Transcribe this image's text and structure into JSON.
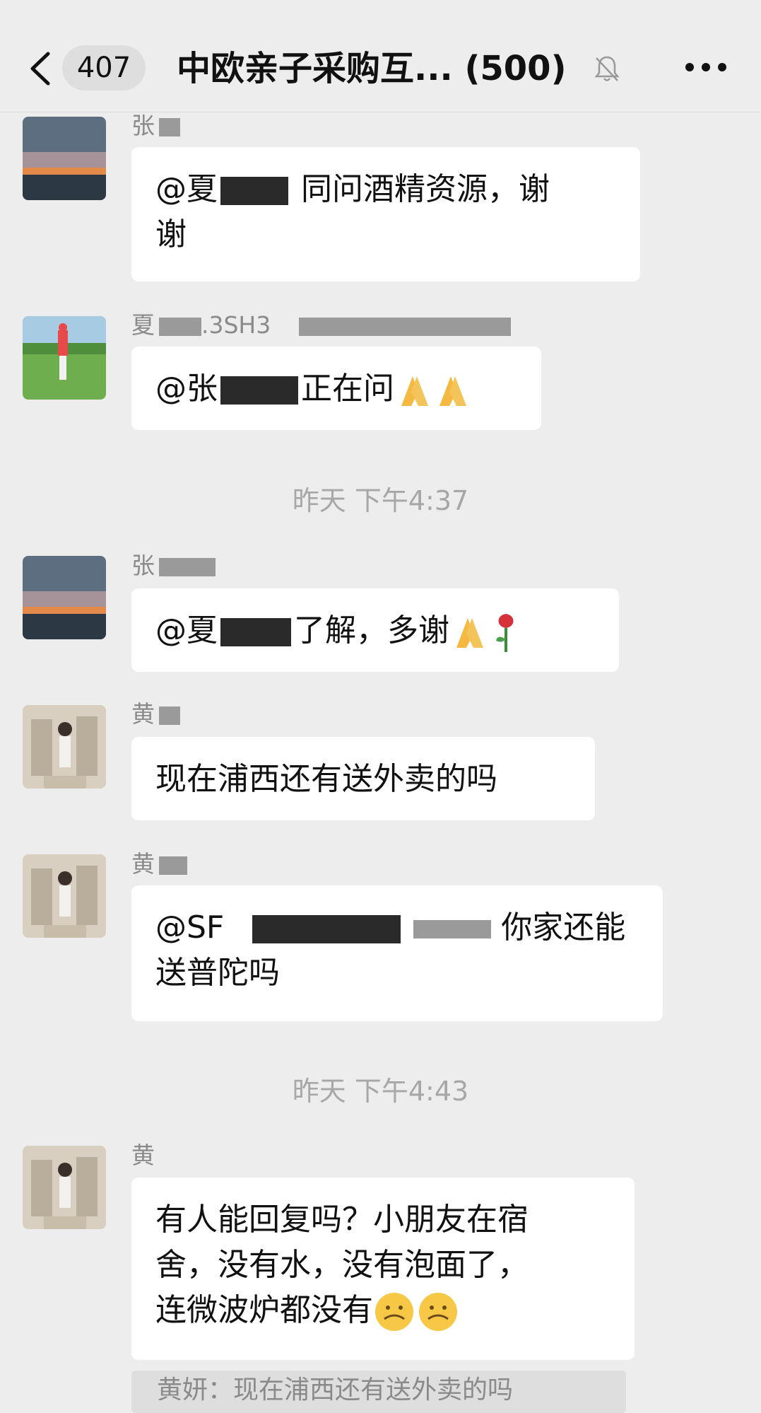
{
  "header": {
    "unread_count": "407",
    "title": "中欧亲子采购互...",
    "member_count": "(500)"
  },
  "messages": [
    {
      "sender": "张",
      "text_prefix": "@夏",
      "text_line1": "同问酒精资源，谢",
      "text_line2": "谢"
    },
    {
      "sender": "夏",
      "sender_suffix": ".3SH3",
      "text_prefix": "@张",
      "text": "正在问"
    },
    {
      "sender": "张",
      "text_prefix": "@夏",
      "text": "了解，多谢"
    },
    {
      "sender": "黄",
      "text": "现在浦西还有送外卖的吗"
    },
    {
      "sender": "黄",
      "text_prefix": "@SF",
      "text_line1": "你家还能",
      "text_line2": "送普陀吗"
    },
    {
      "sender": "黄",
      "text_line1": "有人能回复吗？小朋友在宿",
      "text_line2": "舍，没有水，没有泡面了，",
      "text_line3": "连微波炉都没有"
    }
  ],
  "timestamps": [
    "昨天 下午4:37",
    "昨天 下午4:43"
  ],
  "quote": "黄妍：现在浦西还有送外卖的吗",
  "icons": [
    "back-icon",
    "mute-icon",
    "more-icon",
    "pray-emoji",
    "rose-emoji",
    "worried-emoji"
  ],
  "colors": {
    "background": "#ededed",
    "bubble": "#ffffff",
    "meta_text": "#a7a7a7"
  }
}
